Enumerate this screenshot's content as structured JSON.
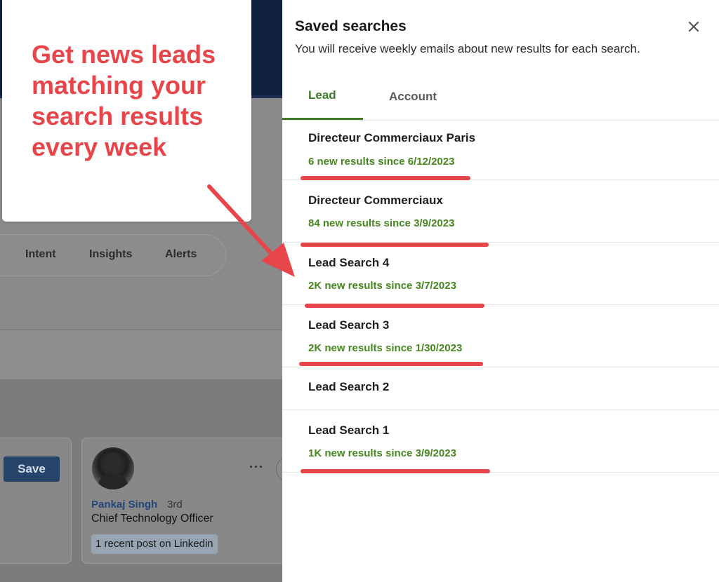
{
  "callout": {
    "text": "Get news leads matching your search results every week"
  },
  "background": {
    "tabs": [
      "Intent",
      "Insights",
      "Alerts"
    ],
    "save_label": "Save",
    "person": {
      "name": "Pankaj Singh",
      "degree": "3rd",
      "title": "Chief Technology Officer",
      "recent_post": "1 recent post on Linkedin"
    },
    "more_label": "···"
  },
  "panel": {
    "title": "Saved searches",
    "subtitle": "You will receive weekly emails about new results for each search.",
    "close_icon": "×",
    "tabs": [
      {
        "label": "Lead",
        "active": true
      },
      {
        "label": "Account",
        "active": false
      }
    ],
    "searches": [
      {
        "name": "Directeur Commerciaux Paris",
        "meta": "6 new results since 6/12/2023"
      },
      {
        "name": "Directeur Commerciaux",
        "meta": "84 new results since 3/9/2023"
      },
      {
        "name": "Lead Search 4",
        "meta": "2K new results since 3/7/2023"
      },
      {
        "name": "Lead Search 3",
        "meta": "2K new results since 1/30/2023"
      },
      {
        "name": "Lead Search 2",
        "meta": ""
      },
      {
        "name": "Lead Search 1",
        "meta": "1K new results since 3/9/2023"
      }
    ]
  },
  "colors": {
    "accent_green": "#3d7a2a",
    "highlight_red": "#e8454a",
    "nav_dark": "#0f203d"
  }
}
